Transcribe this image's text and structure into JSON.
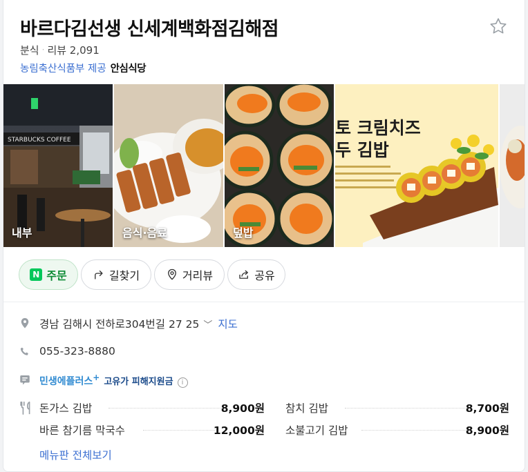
{
  "place": {
    "name": "바르다김선생 신세계백화점김해점",
    "category": "분식",
    "separator": "·",
    "review_label": "리뷰 2,091",
    "provider": "농림축산식품부 제공",
    "badge": "안심식당"
  },
  "photos": [
    {
      "caption": "내부"
    },
    {
      "caption": "음식·음료"
    },
    {
      "caption": "덮밥"
    },
    {
      "caption": "",
      "overlay_line1": "토 크림치즈",
      "overlay_line2": "두 김밥"
    },
    {
      "caption": ""
    }
  ],
  "photo_sign": "STARBUCKS COFFEE",
  "actions": {
    "order": "주문",
    "order_badge": "N",
    "directions": "길찾기",
    "streetview": "거리뷰",
    "share": "공유"
  },
  "info": {
    "address": "경남 김해시 전하로304번길 27 25",
    "map_link": "지도",
    "phone": "055-323-8880",
    "promo_brand": "민생에플러스",
    "promo_plus": "+",
    "promo_text": "고유가 피해지원금",
    "promo_info": "i"
  },
  "menu": {
    "items": [
      {
        "name": "돈가스 김밥",
        "price": "8,900원"
      },
      {
        "name": "참치 김밥",
        "price": "8,700원"
      },
      {
        "name": "바른 참기름 막국수",
        "price": "12,000원"
      },
      {
        "name": "소불고기 김밥",
        "price": "8,900원"
      }
    ],
    "more_label": "메뉴판 전체보기"
  },
  "colors": {
    "link": "#3b6fd1",
    "naver_green": "#03c75a",
    "promo_blue": "#2f8ad1"
  },
  "icons": [
    "star-icon",
    "location-icon",
    "phone-icon",
    "promo-icon",
    "fork-knife-icon",
    "directions-icon",
    "streetview-pin-icon",
    "share-icon"
  ]
}
